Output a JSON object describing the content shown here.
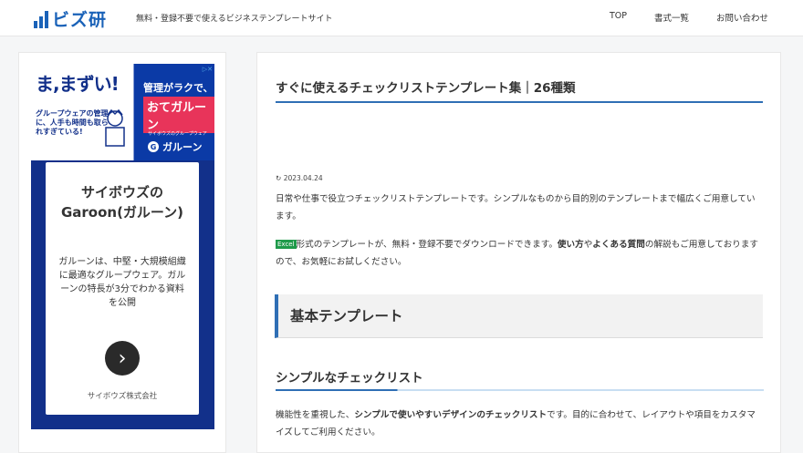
{
  "header": {
    "logo_text": "ビズ研",
    "tagline": "無料・登録不要で使えるビジネステンプレートサイト",
    "nav": [
      "TOP",
      "書式一覧",
      "お問い合わせ"
    ]
  },
  "ad": {
    "headline": "ま,まずい!",
    "sub_lines": "グループウェアの管理に、人手も時間も取られすぎている!",
    "right_line1": "管理がラクで、",
    "right_line2": "おてガルーン",
    "brand_small": "サイボウズのグループウェア",
    "brand": "ガルーン",
    "card_title": "サイボウズのGaroon(ガルーン)",
    "card_desc": "ガルーンは、中堅・大規模組織に最適なグループウェア。ガルーンの特長が3分でわかる資料を公開",
    "company": "サイボウズ株式会社"
  },
  "main": {
    "title": "すぐに使えるチェックリストテンプレート集｜26種類",
    "date": "2023.04.24",
    "intro": "日常や仕事で役立つチェックリストテンプレートです。シンプルなものから目的別のテンプレートまで幅広くご用意しています。",
    "excel_badge": "Excel",
    "p2_a": "形式のテンプレートが、無料・登録不要でダウンロードできます。",
    "p2_b": "使い方",
    "p2_c": "や",
    "p2_d": "よくある質問",
    "p2_e": "の解説もご用意しておりますので、お気軽にお試しください。",
    "h2": "基本テンプレート",
    "h3": "シンプルなチェックリスト",
    "p3_a": "機能性を重視した、",
    "p3_b": "シンプルで使いやすいデザインのチェックリスト",
    "p3_c": "です。目的に合わせて、レイアウトや項目をカスタマイズしてご利用ください。"
  },
  "colors": {
    "brand": "#1a62b8",
    "accent": "#2f6fb5",
    "excel": "#1f9a4a"
  }
}
